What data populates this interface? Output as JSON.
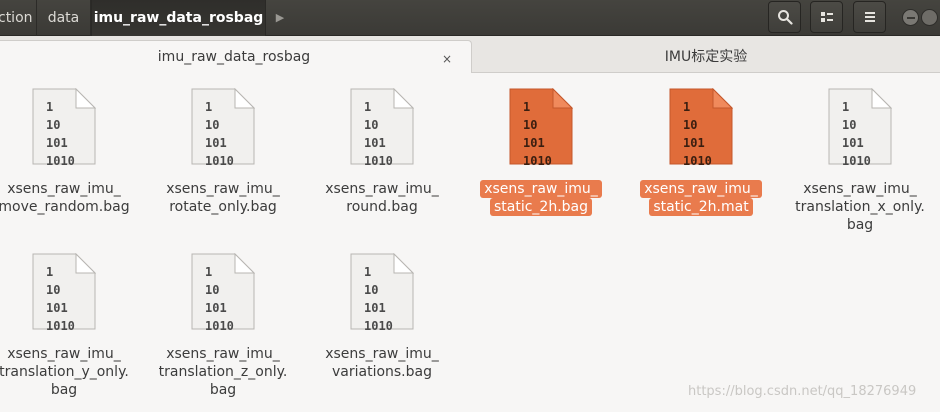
{
  "breadcrumbs": [
    "ction",
    "data",
    "imu_raw_data_rosbag"
  ],
  "breadcrumb_more_icon": "chevron-right-icon",
  "header_buttons": [
    "search-icon",
    "view-options-icon",
    "hamburger-menu-icon"
  ],
  "tabs": [
    {
      "label": "imu_raw_data_rosbag",
      "close": "×",
      "active": true
    },
    {
      "label": "IMU标定实验",
      "active": false
    }
  ],
  "file_icon_text": [
    "1",
    "10",
    "101",
    "1010"
  ],
  "files": [
    {
      "name_lines": [
        "xsens_raw_imu_",
        "move_random.bag"
      ],
      "selected": false
    },
    {
      "name_lines": [
        "xsens_raw_imu_",
        "rotate_only.bag"
      ],
      "selected": false
    },
    {
      "name_lines": [
        "xsens_raw_imu_",
        "round.bag"
      ],
      "selected": false
    },
    {
      "name_lines": [
        "xsens_raw_imu_",
        "static_2h.bag"
      ],
      "selected": true
    },
    {
      "name_lines": [
        "xsens_raw_imu_",
        "static_2h.mat"
      ],
      "selected": true
    },
    {
      "name_lines": [
        "xsens_raw_imu_",
        "translation_x_only.",
        "bag"
      ],
      "selected": false
    },
    {
      "name_lines": [
        "xsens_raw_imu_",
        "translation_y_only.",
        "bag"
      ],
      "selected": false
    },
    {
      "name_lines": [
        "xsens_raw_imu_",
        "translation_z_only.",
        "bag"
      ],
      "selected": false
    },
    {
      "name_lines": [
        "xsens_raw_imu_",
        "variations.bag"
      ],
      "selected": false
    }
  ],
  "colors": {
    "selection": "#e97b4d",
    "selected_icon": "#e06c3a",
    "headerbar": "#3f3e3a"
  },
  "watermark": "https://blog.csdn.net/qq_18276949"
}
